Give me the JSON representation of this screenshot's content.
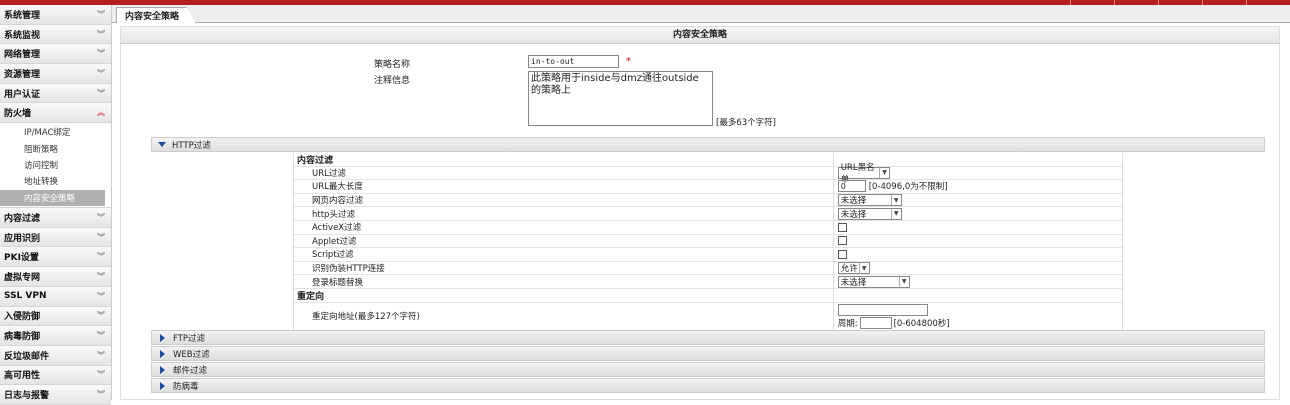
{
  "sidebar": {
    "categories_top": [
      {
        "label": "系统管理"
      },
      {
        "label": "系统监视"
      },
      {
        "label": "网络管理"
      },
      {
        "label": "资源管理"
      },
      {
        "label": "用户认证"
      }
    ],
    "open_category": {
      "label": "防火墙"
    },
    "sub_items": [
      {
        "label": "IP/MAC绑定"
      },
      {
        "label": "阻断策略"
      },
      {
        "label": "访问控制"
      },
      {
        "label": "地址转换"
      },
      {
        "label": "内容安全策略"
      }
    ],
    "categories_bottom": [
      {
        "label": "内容过滤"
      },
      {
        "label": "应用识别"
      },
      {
        "label": "PKI设置"
      },
      {
        "label": "虚拟专网"
      },
      {
        "label": "SSL VPN"
      },
      {
        "label": "入侵防御"
      },
      {
        "label": "病毒防御"
      },
      {
        "label": "反垃圾邮件"
      },
      {
        "label": "高可用性"
      },
      {
        "label": "日志与报警"
      }
    ],
    "chevron": "»"
  },
  "tab": {
    "label": "内容安全策略"
  },
  "panel": {
    "title": "内容安全策略"
  },
  "form": {
    "name_label": "策略名称",
    "name_value": "in-to-out",
    "required_mark": "*",
    "comment_label": "注释信息",
    "comment_line1": "此策略用于inside与dmz通往outside",
    "comment_line2": "的策略上",
    "comment_hint": "[最多63个字符]"
  },
  "http_section": {
    "label": "HTTP过滤",
    "group_content": "内容过滤",
    "rows": {
      "url_filter": {
        "label": "URL过滤",
        "value": "URL黑名单"
      },
      "url_maxlen": {
        "label": "URL最大长度",
        "value": "0",
        "hint": "[0-4096,0为不限制]"
      },
      "page_filter": {
        "label": "网页内容过滤",
        "value": "未选择"
      },
      "header_filter": {
        "label": "http头过滤",
        "value": "未选择"
      },
      "activex": {
        "label": "ActiveX过滤"
      },
      "applet": {
        "label": "Applet过滤"
      },
      "script": {
        "label": "Script过滤"
      },
      "fake_http": {
        "label": "识别伪装HTTP连接",
        "value": "允许"
      },
      "login_title": {
        "label": "登录标题替换",
        "value": "未选择"
      }
    },
    "group_redirect": "重定向",
    "redirect": {
      "label": "重定向地址(最多127个字符)",
      "period_label": "周期:",
      "period_hint": "[0-604800秒]"
    }
  },
  "sections": [
    {
      "label": "FTP过滤"
    },
    {
      "label": "WEB过滤"
    },
    {
      "label": "邮件过滤"
    },
    {
      "label": "防病毒"
    }
  ],
  "colors": {
    "brand": "#b41e1e",
    "accent": "#1a4fa0",
    "required": "#dd0000"
  }
}
